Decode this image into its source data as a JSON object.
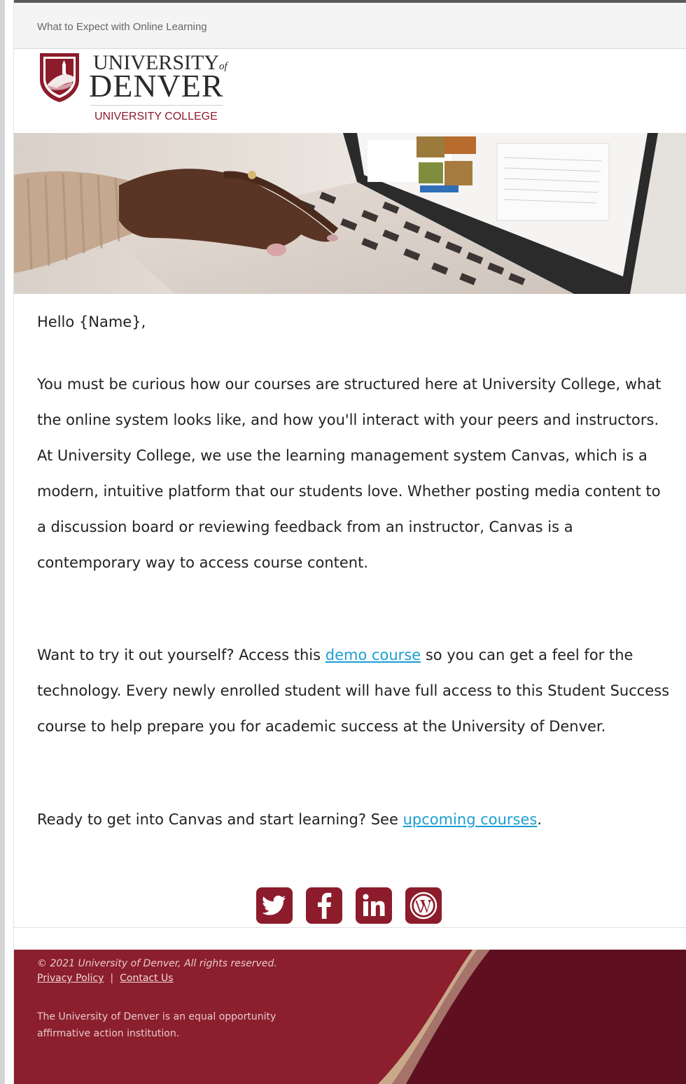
{
  "preheader": {
    "text": "What to Expect with Online Learning"
  },
  "logo": {
    "line1_main": "UNIVERSITY",
    "line1_of": "of",
    "line2": "DENVER",
    "line3": "UNIVERSITY COLLEGE"
  },
  "hero": {
    "alt_icon": "laptop-typing-photo"
  },
  "body": {
    "greeting": "Hello {Name},",
    "para1": "You must be curious how our courses are structured here at University College, what the online system looks like, and how you'll interact with your peers and instructors. At University College, we use the learning management system Canvas, which is a modern, intuitive platform that our students love. Whether posting media content to a discussion board or reviewing feedback from an instructor, Canvas is a contemporary way to access course content.",
    "para2_before": "Want to try it out yourself? Access this ",
    "para2_link": "demo course",
    "para2_after": " so you can get a feel for the technology. Every newly enrolled student will have full access to this Student Success course to help prepare you for academic success at the University of Denver.",
    "para3_before": "Ready to get into Canvas and start learning? See ",
    "para3_link": "upcoming courses",
    "para3_after": "."
  },
  "social": [
    {
      "icon": "twitter-icon"
    },
    {
      "icon": "facebook-icon"
    },
    {
      "icon": "linkedin-icon"
    },
    {
      "icon": "wordpress-icon"
    }
  ],
  "footer": {
    "copyright": "© 2021 University of Denver, All rights reserved.",
    "privacy": "Privacy Policy",
    "separator": "|",
    "contact": "Contact Us",
    "eo_statement": "The University of Denver is an equal opportunity affirmative action institution."
  },
  "colors": {
    "brand": "#8c1c2b",
    "footer_dark": "#5e1020",
    "link": "#1a9ed3",
    "accent_gold": "#c9a88a"
  }
}
